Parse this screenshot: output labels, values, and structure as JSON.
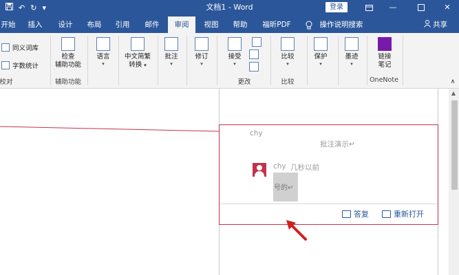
{
  "titlebar": {
    "title": "文档1 - Word",
    "save_icon": "save-icon",
    "undo_icon": "undo-icon",
    "redo_icon": "redo-icon",
    "customize_icon": "customize-qat-icon",
    "login_label": "登录",
    "ribbon_options_icon": "ribbon-display-options-icon",
    "minimize_icon": "minimize-icon",
    "maximize_icon": "maximize-icon",
    "close_icon": "close-icon",
    "accent": "#2b579a"
  },
  "tabs": [
    {
      "label": "开始"
    },
    {
      "label": "插入"
    },
    {
      "label": "设计"
    },
    {
      "label": "布局"
    },
    {
      "label": "引用"
    },
    {
      "label": "邮件"
    },
    {
      "label": "审阅",
      "active": true
    },
    {
      "label": "视图"
    },
    {
      "label": "帮助"
    },
    {
      "label": "福昕PDF"
    },
    {
      "label": "操作说明搜索"
    },
    {
      "label": "共享"
    }
  ],
  "ribbon": {
    "proofing": {
      "thesaurus": "同义词库",
      "word_count": "字数统计",
      "group_label": "校对"
    },
    "accessibility": {
      "check": "检查",
      "check_line2": "辅助功能",
      "group_label": "辅助功能"
    },
    "language": {
      "label": "语言"
    },
    "chinese": {
      "label": "中文简繁",
      "label2": "转换"
    },
    "comments": {
      "label": "批注"
    },
    "tracking": {
      "label": "修订"
    },
    "changes": {
      "accept": "接受",
      "group_label": "更改"
    },
    "compare": {
      "label": "比较",
      "group_label": "比较"
    },
    "protect": {
      "label": "保护"
    },
    "ink": {
      "label": "墨迹"
    },
    "onenote": {
      "label": "链接",
      "label2": "笔记",
      "group_label": "OneNote"
    }
  },
  "comment": {
    "author": "chy",
    "text": "批注演示↵",
    "reply_author": "chy",
    "reply_time": "几秒以前",
    "reply_text": "号的↵",
    "reply_button": "答复",
    "reopen_button": "重新打开",
    "border_color": "#c4314b"
  }
}
